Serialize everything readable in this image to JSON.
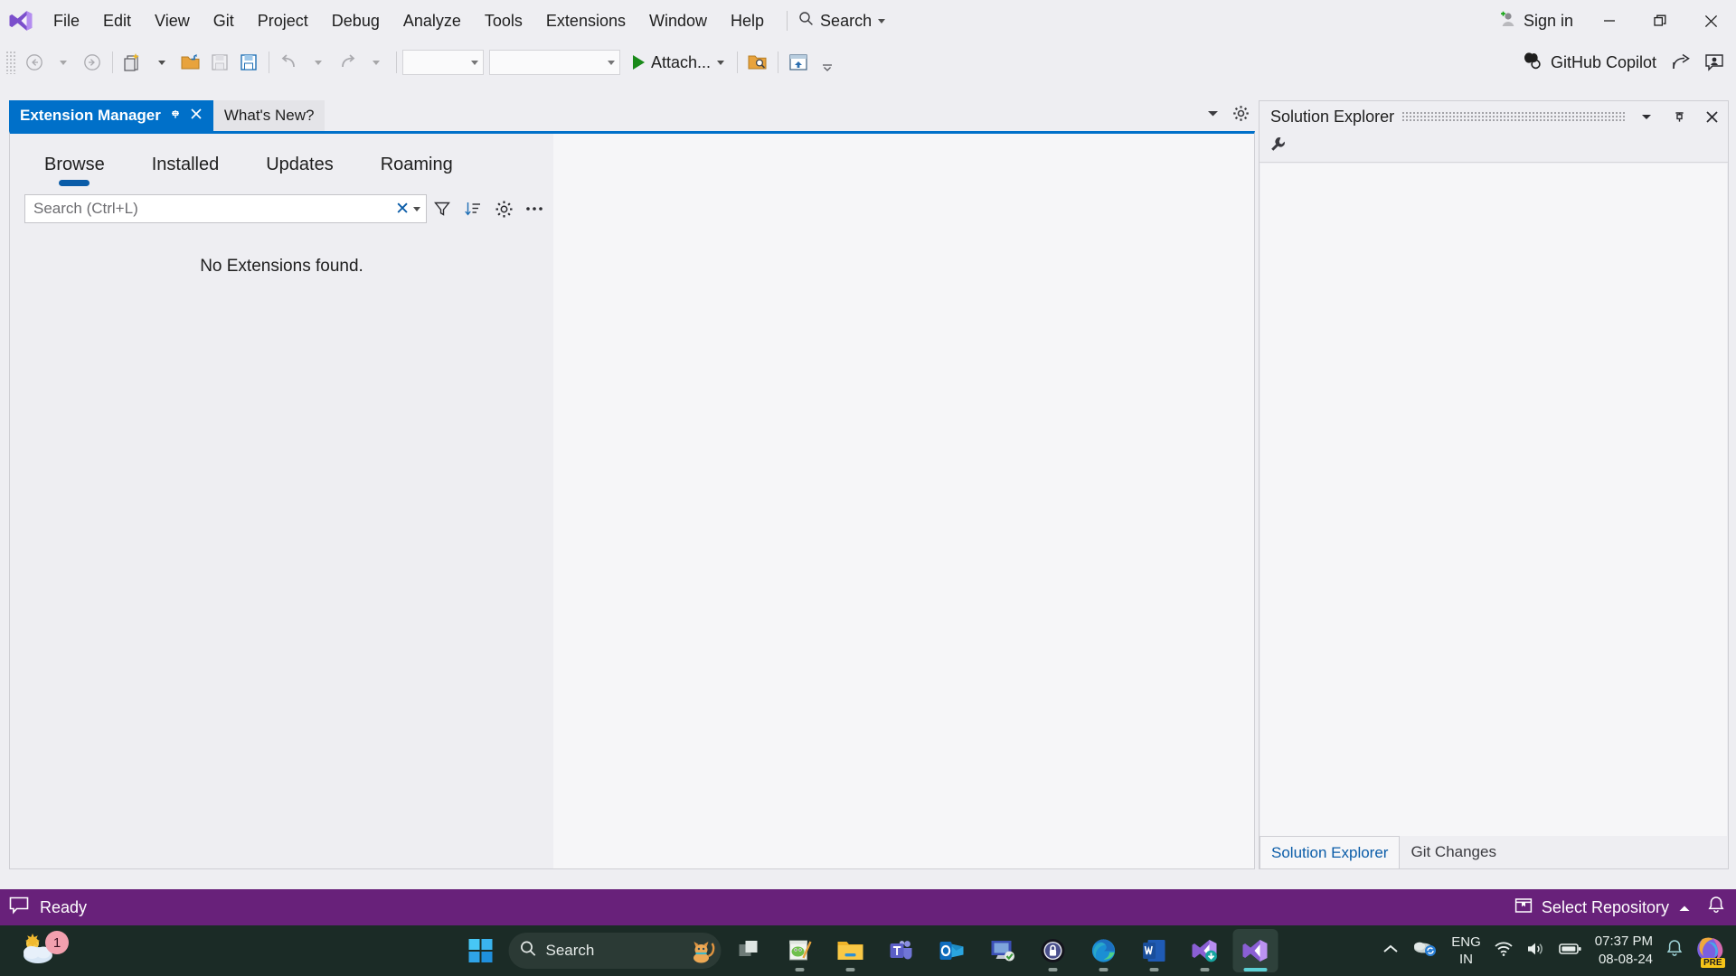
{
  "titlebar": {
    "logo_icon": "visual-studio-logo-icon",
    "menus": [
      "File",
      "Edit",
      "View",
      "Git",
      "Project",
      "Debug",
      "Analyze",
      "Tools",
      "Extensions",
      "Window",
      "Help"
    ],
    "search": {
      "label": "Search",
      "icon": "search-icon",
      "caret_icon": "chevron-down-icon"
    },
    "signin": {
      "label": "Sign in",
      "icon": "add-user-icon"
    },
    "window_controls": {
      "minimize": {
        "icon": "minimize-icon",
        "glyph": "—"
      },
      "restore": {
        "icon": "restore-icon",
        "glyph": "❐"
      },
      "close": {
        "icon": "close-icon",
        "glyph": "✕"
      }
    }
  },
  "toolbar": {
    "back_icon": "navigate-back-icon",
    "forward_icon": "navigate-forward-icon",
    "new_project_icon": "new-project-icon",
    "open_project_icon": "open-folder-icon",
    "save_icon": "save-icon",
    "save_all_icon": "save-all-icon",
    "undo_icon": "undo-icon",
    "redo_icon": "redo-icon",
    "config_combo_value": "",
    "platform_combo_value": "",
    "attach": {
      "label": "Attach...",
      "icon": "run-play-icon",
      "caret_icon": "chevron-down-icon"
    },
    "find_in_files_icon": "find-in-files-icon",
    "layout_icon": "window-layout-icon",
    "overflow_icon": "toolbar-overflow-icon",
    "copilot": {
      "label": "GitHub Copilot",
      "icon": "github-copilot-icon"
    },
    "share_icon": "share-icon",
    "feedback_icon": "feedback-icon"
  },
  "document_tabs": {
    "tabs": [
      {
        "label": "Extension Manager",
        "active": true,
        "pin_icon": "pin-icon",
        "close_icon": "close-icon"
      },
      {
        "label": "What's New?",
        "active": false
      }
    ],
    "dropdown_icon": "tab-list-dropdown-icon",
    "settings_icon": "gear-icon"
  },
  "extension_manager": {
    "tabs": [
      {
        "label": "Browse",
        "selected": true
      },
      {
        "label": "Installed",
        "selected": false
      },
      {
        "label": "Updates",
        "selected": false
      },
      {
        "label": "Roaming",
        "selected": false
      }
    ],
    "search": {
      "placeholder": "Search (Ctrl+L)",
      "value": "",
      "clear_icon": "clear-x-icon",
      "dropdown_icon": "chevron-down-icon"
    },
    "filter_icon": "filter-funnel-icon",
    "sort_icon": "sort-descending-icon",
    "settings_icon": "gear-icon",
    "more_icon": "more-ellipsis-icon",
    "empty_message": "No Extensions found."
  },
  "solution_explorer": {
    "title": "Solution Explorer",
    "dropdown_icon": "chevron-down-icon",
    "pin_icon": "pin-icon",
    "close_icon": "close-icon",
    "toolbar_icon": "properties-wrench-icon",
    "bottom_tabs": [
      {
        "label": "Solution Explorer",
        "active": true
      },
      {
        "label": "Git Changes",
        "active": false
      }
    ]
  },
  "statusbar": {
    "status_icon": "message-balloon-icon",
    "status_text": "Ready",
    "repository": {
      "label": "Select Repository",
      "icon": "repository-icon",
      "caret_icon": "chevron-up-icon"
    },
    "notification_icon": "bell-icon",
    "color": "#68217a"
  },
  "taskbar": {
    "weather": {
      "icon": "weather-cloud-icon",
      "badge": "1"
    },
    "start_icon": "windows-start-icon",
    "search": {
      "placeholder": "Search",
      "icon": "search-icon",
      "mascot_icon": "cat-mascot-icon"
    },
    "pinned": [
      {
        "name": "task-view-icon",
        "running": false
      },
      {
        "name": "notepad-icon",
        "running": true
      },
      {
        "name": "file-explorer-icon",
        "running": true
      },
      {
        "name": "microsoft-teams-icon",
        "running": false
      },
      {
        "name": "outlook-icon",
        "running": false
      },
      {
        "name": "remote-desktop-icon",
        "running": false
      },
      {
        "name": "keepass-icon",
        "running": true
      },
      {
        "name": "microsoft-edge-icon",
        "running": true
      },
      {
        "name": "microsoft-word-icon",
        "running": true
      },
      {
        "name": "visual-studio-installer-icon",
        "running": true
      },
      {
        "name": "visual-studio-icon",
        "running": true,
        "active": true
      }
    ],
    "tray": {
      "overflow_icon": "chevron-up-icon",
      "onedrive_icon": "onedrive-sync-icon",
      "language": {
        "line1": "ENG",
        "line2": "IN"
      },
      "wifi_icon": "wifi-icon",
      "volume_icon": "volume-icon",
      "battery_icon": "battery-icon",
      "clock": {
        "time": "07:37 PM",
        "date": "08-08-24"
      },
      "notifications_icon": "bell-icon",
      "copilot_icon": "copilot-preview-icon",
      "copilot_badge": "PRE"
    }
  },
  "colors": {
    "accent_blue": "#0070c9",
    "status_purple": "#68217a",
    "taskbar": "#1b2b26",
    "chrome": "#eeeef2"
  }
}
